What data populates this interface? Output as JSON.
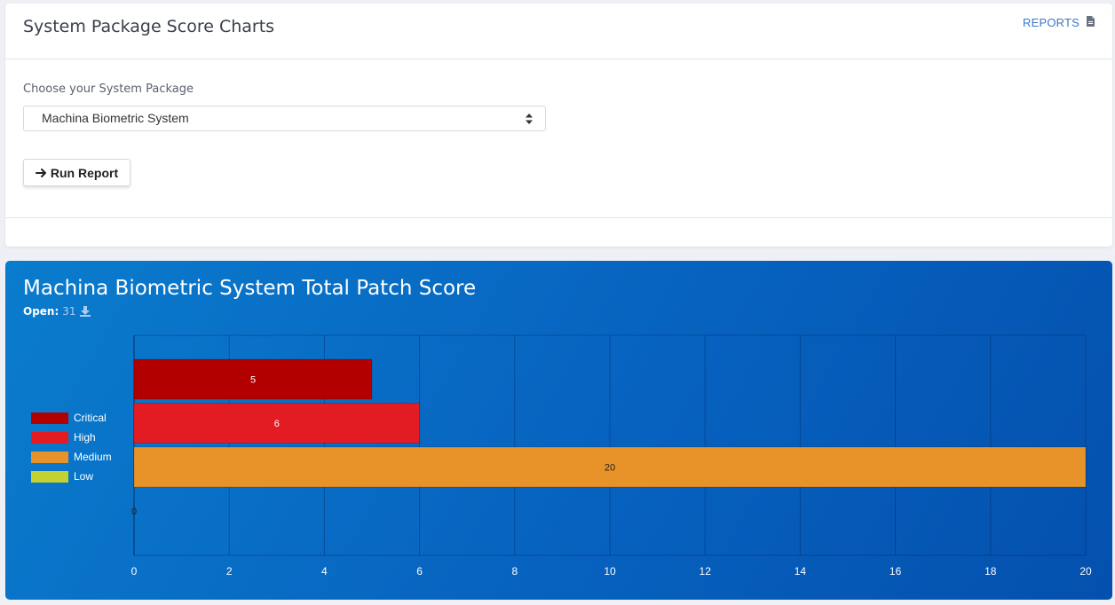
{
  "header": {
    "title": "System Package Score Charts",
    "reports_label": "REPORTS",
    "reports_icon": "document-icon"
  },
  "form": {
    "select_label": "Choose your System Package",
    "selected_package": "Machina Biometric System",
    "run_button_label": "Run Report",
    "run_button_icon": "arrow-right-icon"
  },
  "chart_card": {
    "title": "Machina Biometric System Total Patch Score",
    "open_label": "Open:",
    "open_count": "31",
    "download_icon": "download-icon"
  },
  "colors": {
    "critical": "#b20000",
    "high": "#e31b23",
    "medium": "#e8922a",
    "low": "#c3d232"
  },
  "chart_data": {
    "type": "bar",
    "orientation": "horizontal",
    "categories": [
      "Critical",
      "High",
      "Medium",
      "Low"
    ],
    "values": [
      5,
      6,
      20,
      0
    ],
    "data_labels": [
      "5",
      "6",
      "20",
      "0"
    ],
    "xlim": [
      0,
      20
    ],
    "x_ticks": [
      "0",
      "2",
      "4",
      "6",
      "8",
      "10",
      "12",
      "14",
      "16",
      "18",
      "20"
    ],
    "legend": [
      "Critical",
      "High",
      "Medium",
      "Low"
    ],
    "legend_position": "left",
    "grid": true
  }
}
